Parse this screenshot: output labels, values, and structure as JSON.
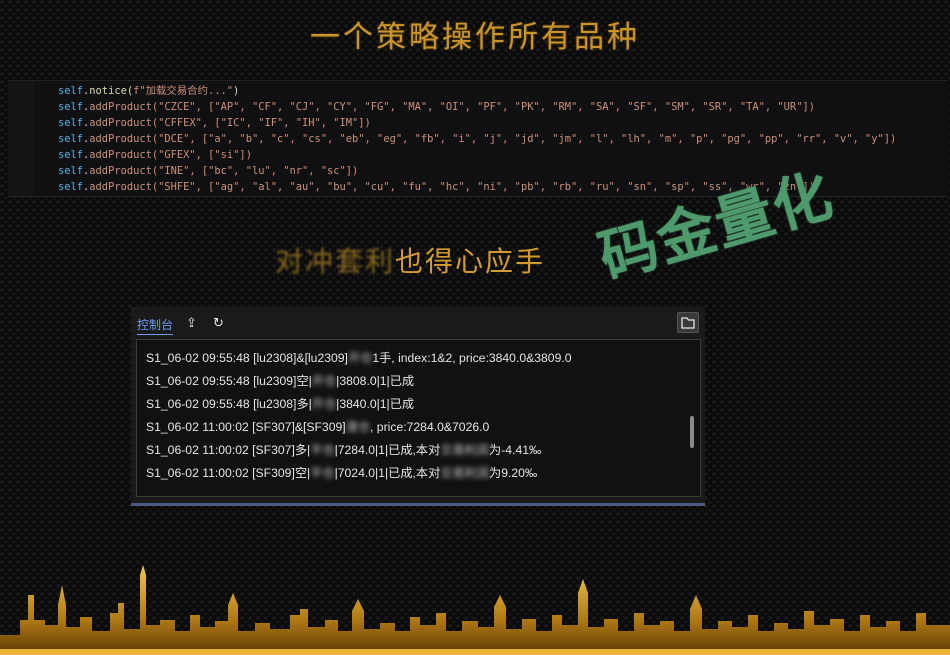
{
  "page_title": "一个策略操作所有品种",
  "code_lines": [
    {
      "text": "addProduct(\"CZCE\", [\"AP\", \"CF\", \"CJ\", \"CY\", \"FG\", \"MA\", \"OI\", \"PF\", \"PK\", \"RM\", \"SA\", \"SF\", \"SM\", \"SR\", \"TA\", \"UR\"])"
    },
    {
      "text": "addProduct(\"CFFEX\", [\"IC\", \"IF\", \"IH\", \"IM\"])"
    },
    {
      "text": "addProduct(\"DCE\", [\"a\", \"b\", \"c\", \"cs\", \"eb\", \"eg\", \"fb\", \"i\", \"j\", \"jd\", \"jm\", \"l\", \"lh\", \"m\", \"p\", \"pg\", \"pp\", \"rr\", \"v\", \"y\"])"
    },
    {
      "text": "addProduct(\"GFEX\", [\"si\"])"
    },
    {
      "text": "addProduct(\"INE\", [\"bc\", \"lu\", \"nr\", \"sc\"])"
    },
    {
      "text": "addProduct(\"SHFE\", [\"ag\", \"al\", \"au\", \"bu\", \"cu\", \"fu\", \"hc\", \"ni\", \"pb\", \"rb\", \"ru\", \"sn\", \"sp\", \"ss\", \"wr\", \"zn\"])"
    }
  ],
  "code_notice": {
    "prefix": "self",
    "dot": ".",
    "method": "notice(",
    "arg": "f\"加载交易合约...\"",
    "close": ")"
  },
  "code_self": "self",
  "subtitle_blurred": "对冲套利",
  "subtitle_rest": "也得心应手",
  "brand": "码金量化",
  "console": {
    "tab_label": "控制台",
    "upload_icon": "⇪",
    "refresh_icon": "↻",
    "lines": [
      {
        "pre": "S1_06-02 09:55:48 [lu2308]&[lu2309]",
        "blur": "开仓",
        "post": "1手, index:1&2, price:3840.0&3809.0"
      },
      {
        "pre": "S1_06-02 09:55:48 [lu2309]空|",
        "blur": "开仓",
        "post": "|3808.0|1|已成"
      },
      {
        "pre": "S1_06-02 09:55:48 [lu2308]多|",
        "blur": "开仓",
        "post": "|3840.0|1|已成"
      },
      {
        "pre": "S1_06-02 11:00:02 [SF307]&[SF309]",
        "blur": "清仓",
        "post": ", price:7284.0&7026.0"
      },
      {
        "pre": "S1_06-02 11:00:02 [SF307]多|",
        "blur": "平仓",
        "post": "|7284.0|1|已成,本对",
        "blur2": "交易利润",
        "post2": "为-4.41‰"
      },
      {
        "pre": "S1_06-02 11:00:02 [SF309]空|",
        "blur": "平仓",
        "post": "|7024.0|1|已成,本对",
        "blur2": "交易利润",
        "post2": "为9.20‰"
      }
    ]
  },
  "colors": {
    "gold": "#c9952b",
    "brand_green": "#4f9a6c",
    "tab_blue": "#6f9cf4"
  }
}
